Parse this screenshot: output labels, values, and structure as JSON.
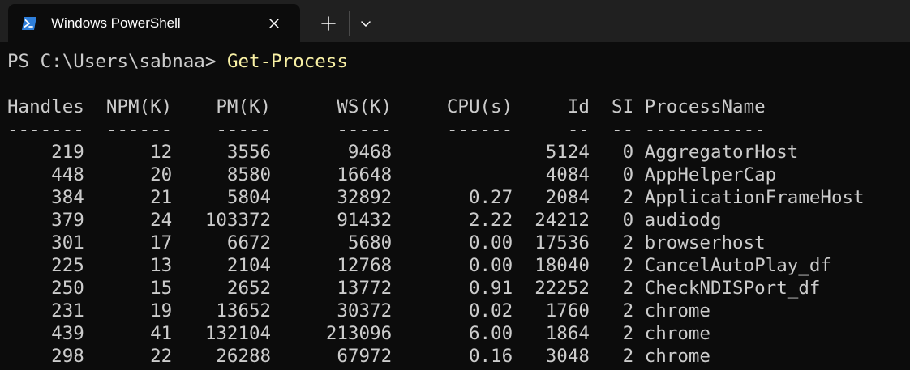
{
  "window": {
    "tab_title": "Windows PowerShell",
    "tab_icon": "powershell-icon",
    "close_icon": "close-icon",
    "new_tab_icon": "plus-icon",
    "dropdown_icon": "chevron-down-icon"
  },
  "colors": {
    "background": "#0c0c0c",
    "tabbar": "#202020",
    "text": "#cccccc",
    "command": "#f9f1a5",
    "ps_icon": "#2f7fdb"
  },
  "terminal": {
    "prompt": "PS C:\\Users\\sabnaa> ",
    "command": "Get-Process",
    "header": "Handles  NPM(K)    PM(K)      WS(K)     CPU(s)     Id  SI ProcessName",
    "separator": "-------  ------    -----      -----     ------     --  -- -----------",
    "rows": [
      "    219      12     3556       9468              5124   0 AggregatorHost",
      "    448      20     8580      16648              4084   0 AppHelperCap",
      "    384      21     5804      32892       0.27   2084   2 ApplicationFrameHost",
      "    379      24   103372      91432       2.22  24212   0 audiodg",
      "    301      17     6672       5680       0.00  17536   2 browserhost",
      "    225      13     2104      12768       0.00  18040   2 CancelAutoPlay_df",
      "    250      15     2652      13772       0.91  22252   2 CheckNDISPort_df",
      "    231      19    13652      30372       0.02   1760   2 chrome",
      "    439      41   132104     213096       6.00   1864   2 chrome",
      "    298      22    26288      67972       0.16   3048   2 chrome"
    ]
  }
}
